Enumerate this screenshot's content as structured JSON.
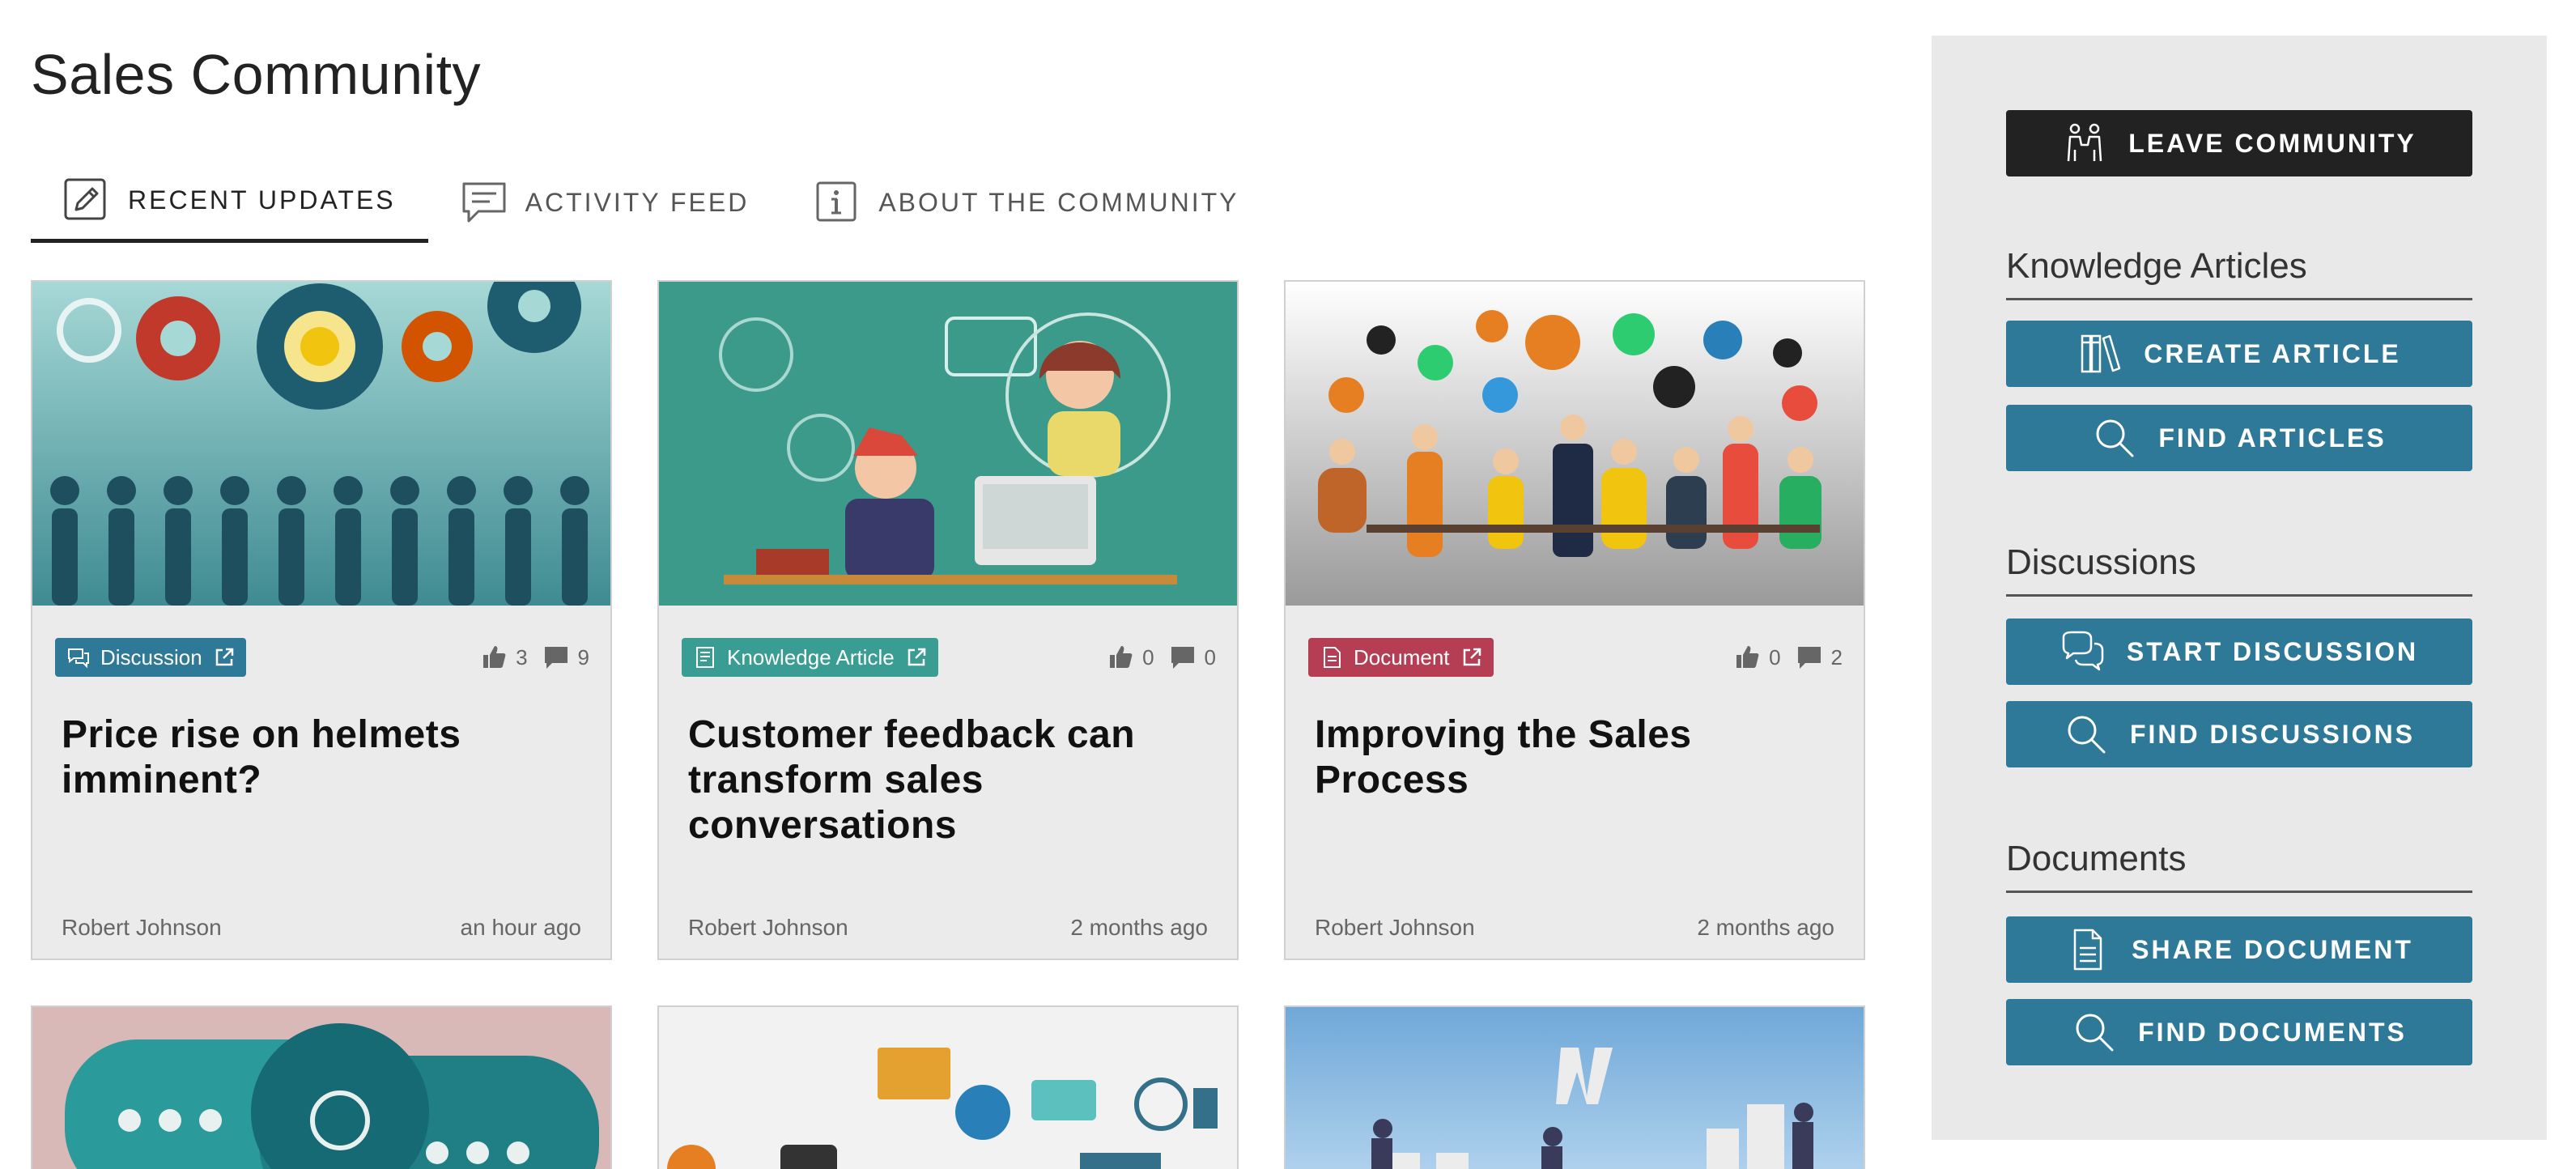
{
  "page": {
    "title": "Sales Community"
  },
  "tabs": [
    {
      "label": "RECENT UPDATES",
      "icon": "edit-icon",
      "active": true
    },
    {
      "label": "ACTIVITY FEED",
      "icon": "comment-icon",
      "active": false
    },
    {
      "label": "ABOUT THE COMMUNITY",
      "icon": "info-icon",
      "active": false
    }
  ],
  "cards": [
    {
      "badge": "Discussion",
      "badge_icon": "discussion-icon",
      "likes": "3",
      "comments": "9",
      "title": "Price rise on helmets imminent?",
      "author": "Robert Johnson",
      "time": "an hour ago"
    },
    {
      "badge": "Knowledge Article",
      "badge_icon": "article-icon",
      "likes": "0",
      "comments": "0",
      "title": "Customer feedback can transform sales conversations",
      "author": "Robert Johnson",
      "time": "2 months ago"
    },
    {
      "badge": "Document",
      "badge_icon": "document-icon",
      "likes": "0",
      "comments": "2",
      "title": "Improving the Sales Process",
      "author": "Robert Johnson",
      "time": "2 months ago"
    }
  ],
  "sidebar": {
    "leave_label": "LEAVE COMMUNITY",
    "sections": [
      {
        "heading": "Knowledge Articles",
        "buttons": [
          "CREATE ARTICLE",
          "FIND ARTICLES"
        ]
      },
      {
        "heading": "Discussions",
        "buttons": [
          "START DISCUSSION",
          "FIND DISCUSSIONS"
        ]
      },
      {
        "heading": "Documents",
        "buttons": [
          "SHARE DOCUMENT",
          "FIND DOCUMENTS"
        ]
      }
    ]
  },
  "colors": {
    "discussion": "#2e7898",
    "article": "#3a9d94",
    "document": "#b53e54",
    "sidebar_button": "#2e7898",
    "leave_button": "#222222"
  }
}
